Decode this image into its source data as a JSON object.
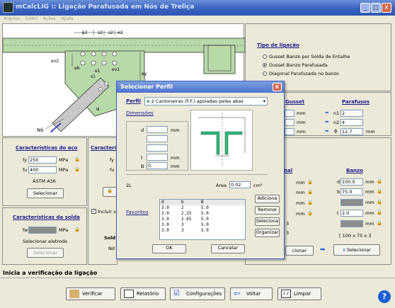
{
  "window": {
    "title": "mCalcLIG :: Ligação Parafusada em Nós de Treliça",
    "min": "_",
    "max": "□",
    "close": "X"
  },
  "menu": [
    "Arquivo",
    "Exibir",
    "Ações",
    "Ajuda"
  ],
  "diagram_labels": {
    "e2a": "e2",
    "s2a": "s2",
    "s2b": "s2",
    "e2b": "e2",
    "ev2": "ev2",
    "eb": "eb",
    "ev1": "ev1",
    "e1": "e1",
    "s1": "s1",
    "ey": "ey",
    "alpha": "α",
    "alpha2": "α",
    "no": "Nó"
  },
  "tipo_ligacao": {
    "title": "Tipo de ligação",
    "options": [
      "Gusset Banzo por Solda de Entalhe",
      "Gusset Banzo Parafusada",
      "Diagonal Parafusada no banzo"
    ],
    "selected": 1
  },
  "gusset": {
    "title": "Gusset",
    "unit": "mm"
  },
  "parafusos": {
    "title": "Parafusos",
    "n1_label": "n1",
    "n1": "2",
    "n2_label": "n2",
    "n2": "4",
    "d_label": "ϕ",
    "d": "12.7",
    "unit": "mm"
  },
  "aco": {
    "title": "Características do aço",
    "fy_label": "fy",
    "fy": "250",
    "fu_label": "fu",
    "fu": "400",
    "unit": "MPa",
    "name": "ASTM A36",
    "button": "Selecionar"
  },
  "col2_title": "Característi",
  "col2_fy": "fy",
  "col2_fu": "fu",
  "incluir": "Incluir v",
  "solda": {
    "title": "Características da solda",
    "fw_label": "fw",
    "unit": "MPa",
    "electrode": "Selecionar eletrodo",
    "button": "Selecionar"
  },
  "sol_partial": "Sold",
  "no_partial": "Nd",
  "nal_partial": "nal",
  "unit_mm": "mm",
  "cionar": "cionar",
  "n3": "3",
  "n3b": "3",
  "banzo": {
    "title": "Banzo",
    "d_label": "d",
    "d": "100.0",
    "b_label": "b",
    "b": "75.0",
    "t_label": "t",
    "t": "2.0",
    "unit": "mm",
    "profile": "[ 100 x 75 x 3",
    "button": "Selecionar"
  },
  "dialog": {
    "title": "Selecionar Perfil",
    "close": "X",
    "perfil_label": "Perfil",
    "perfil_value": "2 Cantoneiras (F.F.) apoiadas pelas abas",
    "dimensoes_label": "Dimensões",
    "dims": [
      {
        "label": "d",
        "value": "",
        "unit": "mm"
      },
      {
        "label": "",
        "value": "",
        "unit": ""
      },
      {
        "label": "",
        "value": "",
        "unit": ""
      },
      {
        "label": "t",
        "value": "",
        "unit": "mm"
      },
      {
        "label": "B",
        "value": "0",
        "unit": "mm"
      }
    ],
    "designation": "2L",
    "area_label": "Área",
    "area": "0.02",
    "area_unit": "cm²",
    "favoritos_label": "Favoritos",
    "table_header": [
      "d",
      "b",
      "B"
    ],
    "table_rows": [
      [
        "3.0",
        "2",
        "5.0"
      ],
      [
        "3.0",
        "2.25",
        "5.0"
      ],
      [
        "3.0",
        "2.65",
        "5.0"
      ],
      [
        "3.0",
        "3",
        "5.0"
      ],
      [
        "3.0",
        "3",
        "5.0"
      ]
    ],
    "side_buttons": [
      "Adiciona",
      "Remove",
      "Seleciona",
      "Organizar"
    ],
    "ok": "OK",
    "cancel": "Cancelar"
  },
  "status": "Inicia a verificação da ligação",
  "buttons": [
    "Verificar",
    "Relatório",
    "Configurações",
    "Voltar",
    "Limpar"
  ],
  "help": "?"
}
